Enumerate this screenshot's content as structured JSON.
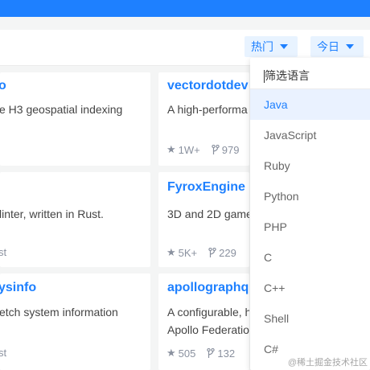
{
  "filters": {
    "sort_label": "热门",
    "period_label": "今日"
  },
  "cards": [
    {
      "title": "o",
      "desc1": "e H3 geospatial indexing",
      "desc2": "",
      "stars": "",
      "forks": ""
    },
    {
      "title": "vectordotdev",
      "desc1": "A high-performa",
      "desc2": "",
      "stars": "1W+",
      "forks": "979"
    },
    {
      "title": "",
      "desc1": "linter, written in Rust.",
      "desc2": "",
      "stars": "",
      "forks": "",
      "tail": "st"
    },
    {
      "title": "FyroxEngine",
      "desc1": "3D and 2D game",
      "desc2": "",
      "stars": "5K+",
      "forks": "229"
    },
    {
      "title": "ysinfo",
      "desc1": "etch system information",
      "desc2": "",
      "stars": "",
      "forks": "",
      "tail": "st"
    },
    {
      "title": "apollographq",
      "desc1": "A configurable, h",
      "desc2": "Apollo Federatio",
      "stars": "505",
      "forks": "132"
    }
  ],
  "dropdown": {
    "filter_placeholder": "筛选语言",
    "languages": [
      "Java",
      "JavaScript",
      "Ruby",
      "Python",
      "PHP",
      "C",
      "C++",
      "Shell",
      "C#"
    ],
    "active": "Java"
  },
  "watermark": "@稀土掘金技术社区"
}
